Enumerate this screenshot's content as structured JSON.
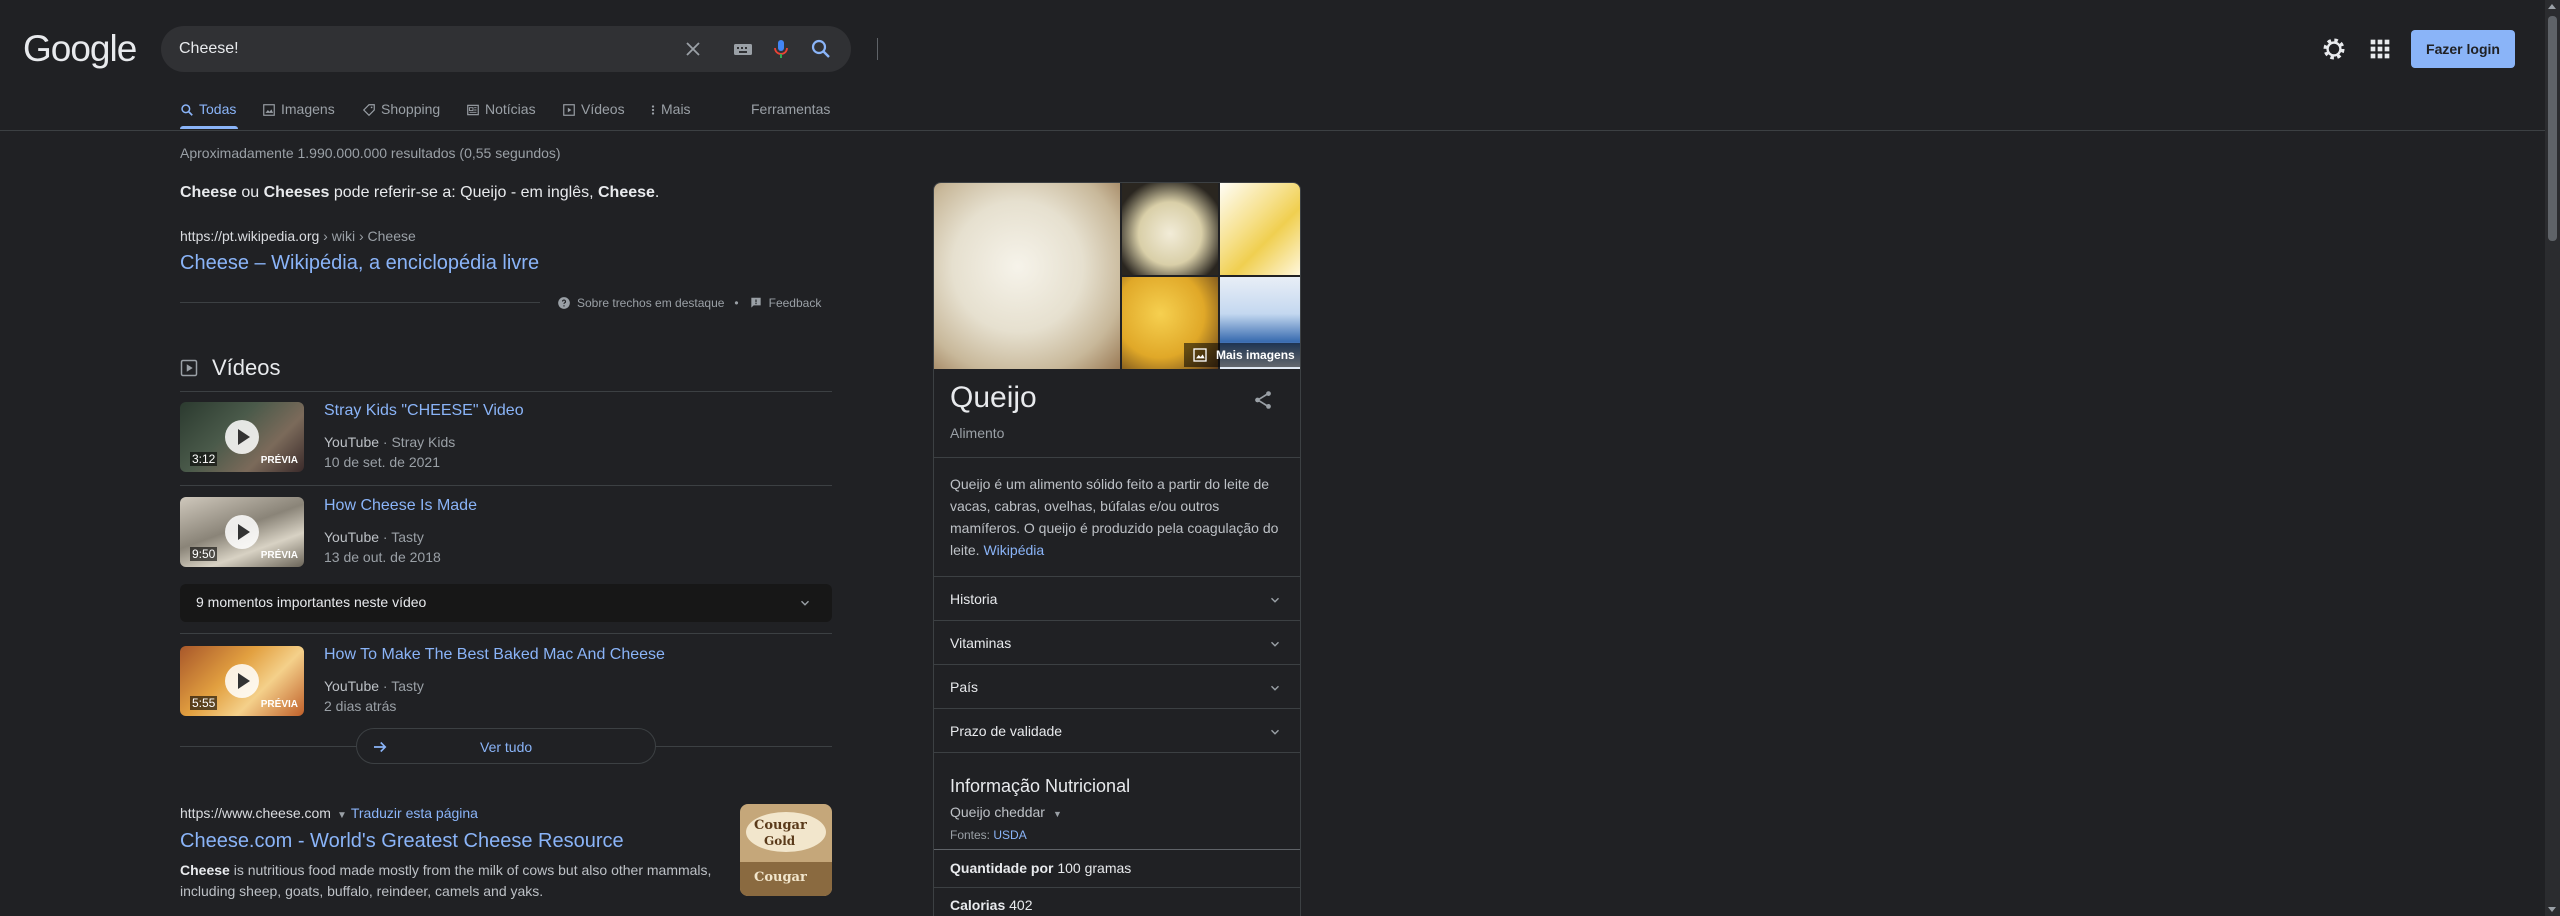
{
  "header": {
    "logo": "Google",
    "search_value": "Cheese!",
    "login_label": "Fazer login"
  },
  "tabs": [
    {
      "label": "Todas",
      "icon": "search-icon",
      "active": true
    },
    {
      "label": "Imagens",
      "icon": "image-icon"
    },
    {
      "label": "Shopping",
      "icon": "tag-icon"
    },
    {
      "label": "Notícias",
      "icon": "news-icon"
    },
    {
      "label": "Vídeos",
      "icon": "play-icon"
    },
    {
      "label": "Mais",
      "icon": "more-vert-icon"
    },
    {
      "label": "Ferramentas"
    }
  ],
  "results": {
    "stats": "Aproximadamente 1.990.000.000 resultados (0,55 segundos)",
    "snippet": {
      "text_parts": [
        "Cheese",
        " ou ",
        "Cheeses",
        " pode referir-se a: Queijo - em inglês, ",
        "Cheese",
        "."
      ],
      "url": "https://pt.wikipedia.org",
      "crumb": " › wiki › Cheese",
      "title": "Cheese – Wikipédia, a enciclopédia livre",
      "about_label": "Sobre trechos em destaque",
      "dot": "•",
      "feedback_label": "Feedback"
    },
    "videos": {
      "heading": "Vídeos",
      "items": [
        {
          "title": "Stray Kids \"CHEESE\" Video",
          "source": "YouTube",
          "channel": "Stray Kids",
          "date": "10 de set. de 2021",
          "duration": "3:12",
          "preview": "PRÉVIA"
        },
        {
          "title": "How Cheese Is Made",
          "source": "YouTube",
          "channel": "Tasty",
          "date": "13 de out. de 2018",
          "duration": "9:50",
          "preview": "PRÉVIA"
        },
        {
          "title": "How To Make The Best Baked Mac And Cheese",
          "source": "YouTube",
          "channel": "Tasty",
          "date": "2 dias atrás",
          "duration": "5:55",
          "preview": "PRÉVIA"
        }
      ],
      "moments_label": "9 momentos importantes neste vídeo",
      "see_all_label": "Ver tudo"
    },
    "second": {
      "url": "https://www.cheese.com",
      "translate_label": "Traduzir esta página",
      "title": "Cheese.com - World's Greatest Cheese Resource",
      "desc_bold": "Cheese",
      "desc_rest": " is nutritious food made mostly from the milk of cows but also other mammals, including sheep, goats, buffalo, reindeer, camels and yaks.",
      "thumb_text_1": "Cougar",
      "thumb_text_2": "Gold",
      "thumb_text_3": "Cougar"
    }
  },
  "knowledge_panel": {
    "more_images_label": "Mais imagens",
    "title": "Queijo",
    "subtitle": "Alimento",
    "description": "Queijo é um alimento sólido feito a partir do leite de vacas, cabras, ovelhas, búfalas e/ou outros mamíferos. O queijo é produzido pela coagulação do leite. ",
    "wiki_link": "Wikipédia",
    "accordions": [
      "Historia",
      "Vitaminas",
      "País",
      "Prazo de validade"
    ],
    "nutrition": {
      "title": "Informação Nutricional",
      "selected": "Queijo cheddar",
      "source_label": "Fontes: ",
      "source_link": "USDA",
      "qty_label": "Quantidade por",
      "qty_value": " 100 gramas",
      "cal_label": "Calorias",
      "cal_value": " 402"
    }
  },
  "colors": {
    "background": "#202124",
    "link": "#8ab4f8",
    "text": "#bdc1c6",
    "heading": "#e8eaed"
  }
}
